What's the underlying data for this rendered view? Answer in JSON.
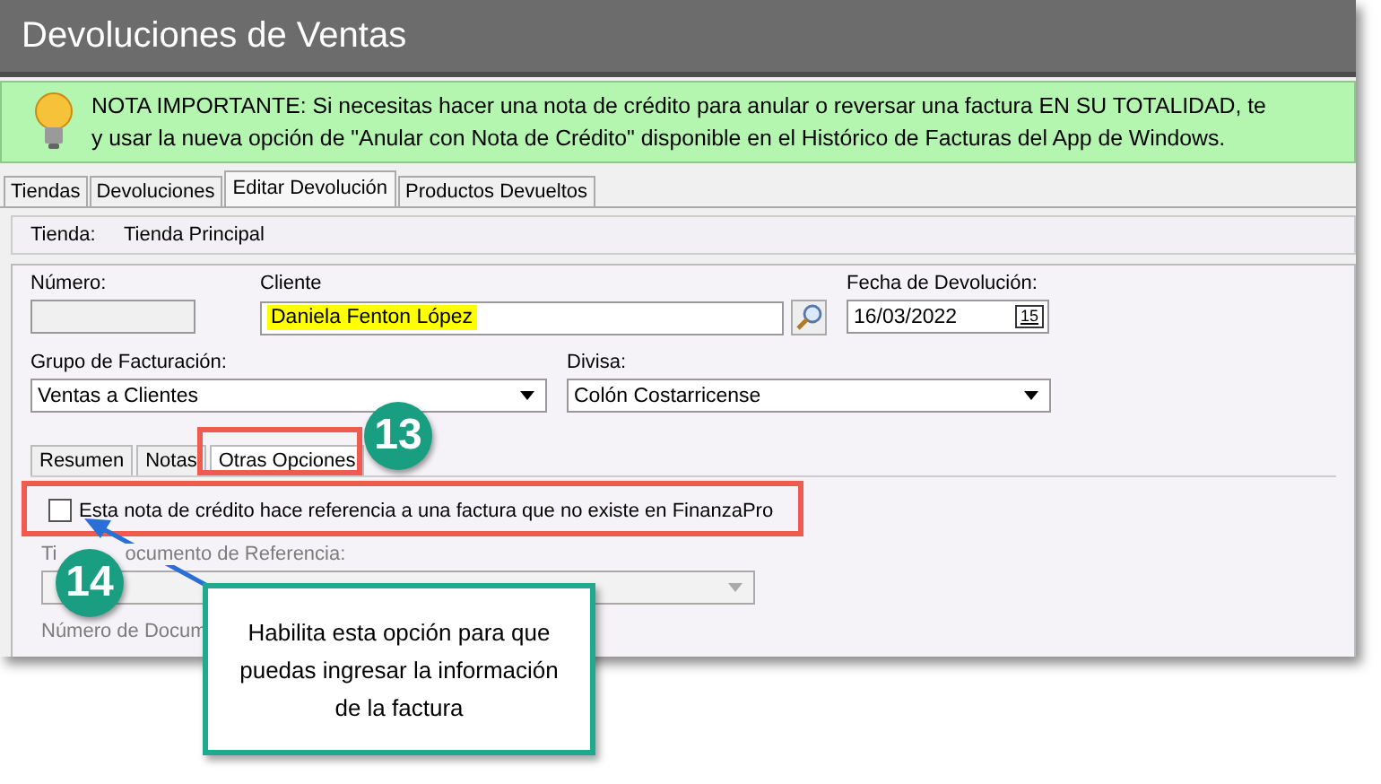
{
  "window": {
    "title": "Devoluciones de Ventas"
  },
  "notice": {
    "lines": [
      "NOTA IMPORTANTE: Si necesitas hacer una nota de crédito para anular o reversar una factura EN SU TOTALIDAD, te",
      "y usar la nueva opción de \"Anular con Nota de Crédito\" disponible en el Histórico de Facturas del App de Windows."
    ]
  },
  "tabs": [
    {
      "label": "Tiendas",
      "selected": false
    },
    {
      "label": "Devoluciones",
      "selected": false
    },
    {
      "label": "Editar Devolución",
      "selected": true
    },
    {
      "label": "Productos Devueltos",
      "selected": false
    }
  ],
  "store": {
    "label": "Tienda:",
    "value": "Tienda Principal"
  },
  "number": {
    "label": "Número:"
  },
  "client": {
    "label": "Cliente",
    "value": "Daniela Fenton López",
    "highlighted": true
  },
  "date": {
    "label": "Fecha de Devolución:",
    "value": "16/03/2022",
    "calendar": "15"
  },
  "billing_group": {
    "label": "Grupo de Facturación:",
    "value": "Ventas a Clientes"
  },
  "currency": {
    "label": "Divisa:",
    "value": "Colón Costarricense"
  },
  "subtabs": [
    {
      "label": "Resumen",
      "selected": false
    },
    {
      "label": "Notas",
      "selected": false
    },
    {
      "label": "Otras Opciones",
      "selected": true
    }
  ],
  "option": {
    "label": "Esta nota de crédito hace referencia a una factura que no existe en FinanzaPro",
    "checked": false
  },
  "disabled_fields": [
    {
      "label_parts": [
        "Ti",
        "ocumento de Referencia:"
      ]
    },
    {
      "label": "Número de Docum"
    }
  ],
  "annotations": {
    "badges": [
      "13",
      "14"
    ],
    "callout": "Habilita esta opción para que puedas ingresar la información de la factura"
  }
}
